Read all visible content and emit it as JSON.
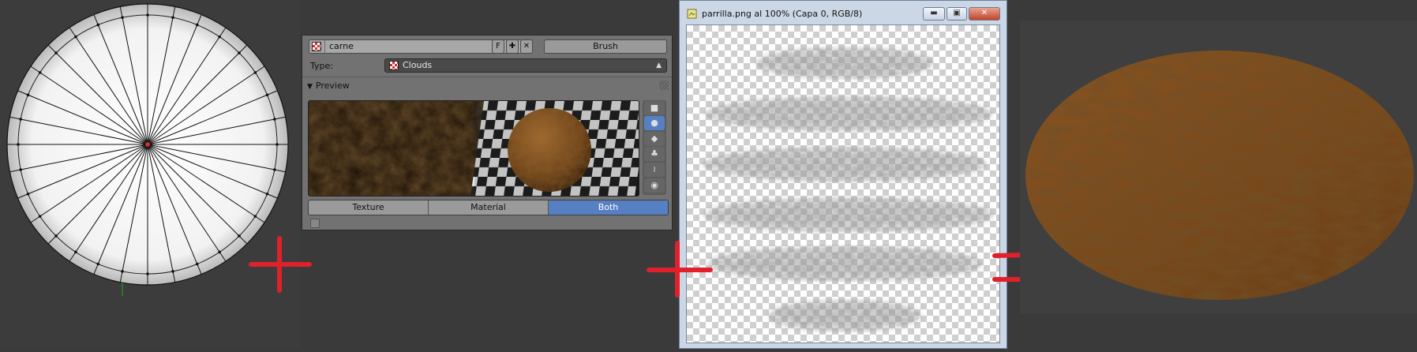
{
  "texture_panel": {
    "texture_name": "carne",
    "fake_user_label": "F",
    "new_icon": "plus-icon",
    "unlink_icon": "close-icon",
    "brush_label": "Brush",
    "type_label": "Type:",
    "type_value": "Clouds",
    "preview_label": "Preview",
    "tabs": [
      {
        "label": "Texture",
        "active": false
      },
      {
        "label": "Material",
        "active": false
      },
      {
        "label": "Both",
        "active": true
      }
    ],
    "preview_side_buttons": [
      "plane-icon",
      "sphere-icon",
      "cube-icon",
      "monkey-icon",
      "hair-icon",
      "sphere-plane-icon"
    ]
  },
  "image_window": {
    "title": "parrilla.png al 100% (Capa 0, RGB/8)",
    "minimize_icon": "minimize-icon",
    "maximize_icon": "maximize-icon",
    "close_icon": "close-icon"
  },
  "colors": {
    "annotation_red": "#e0202a",
    "active_blue": "#5680c2",
    "meat_brown": "#7a4a1c"
  }
}
